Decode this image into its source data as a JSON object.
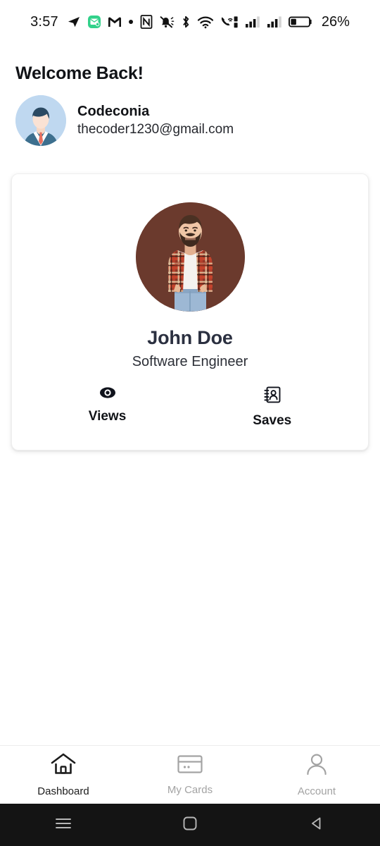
{
  "status_bar": {
    "time": "3:57",
    "battery_percent": "26%",
    "icons": [
      "telegram-icon",
      "mail-badge-icon",
      "gmail-icon",
      "dot-icon",
      "nfc-icon",
      "mute-bell-icon",
      "bluetooth-icon",
      "wifi-icon",
      "call-wifi-icon",
      "signal-bars-1-icon",
      "signal-bars-2-icon",
      "battery-icon"
    ]
  },
  "header": {
    "welcome_title": "Welcome Back!",
    "user_name": "Codeconia",
    "user_email": "thecoder1230@gmail.com",
    "avatar_name": "user-avatar"
  },
  "profile_card": {
    "photo_name": "profile-photo",
    "name": "John Doe",
    "role": "Software Engineer",
    "stats": [
      {
        "label": "Views",
        "icon": "eye-icon"
      },
      {
        "label": "Saves",
        "icon": "address-book-icon"
      }
    ]
  },
  "bottom_nav": {
    "items": [
      {
        "label": "Dashboard",
        "icon": "home-icon",
        "active": true
      },
      {
        "label": "My Cards",
        "icon": "credit-card-icon",
        "active": false
      },
      {
        "label": "Account",
        "icon": "person-icon",
        "active": false
      }
    ]
  },
  "android_nav": {
    "items": [
      {
        "name": "recents-button",
        "icon": "hamburger-icon"
      },
      {
        "name": "home-button",
        "icon": "rounded-square-icon"
      },
      {
        "name": "back-button",
        "icon": "triangle-left-icon"
      }
    ]
  },
  "colors": {
    "accent_green": "#31d18a",
    "photo_background": "#6b3a2d",
    "text_primary": "#111317",
    "text_muted": "#a3a3a3",
    "android_nav_bg": "#141414"
  }
}
